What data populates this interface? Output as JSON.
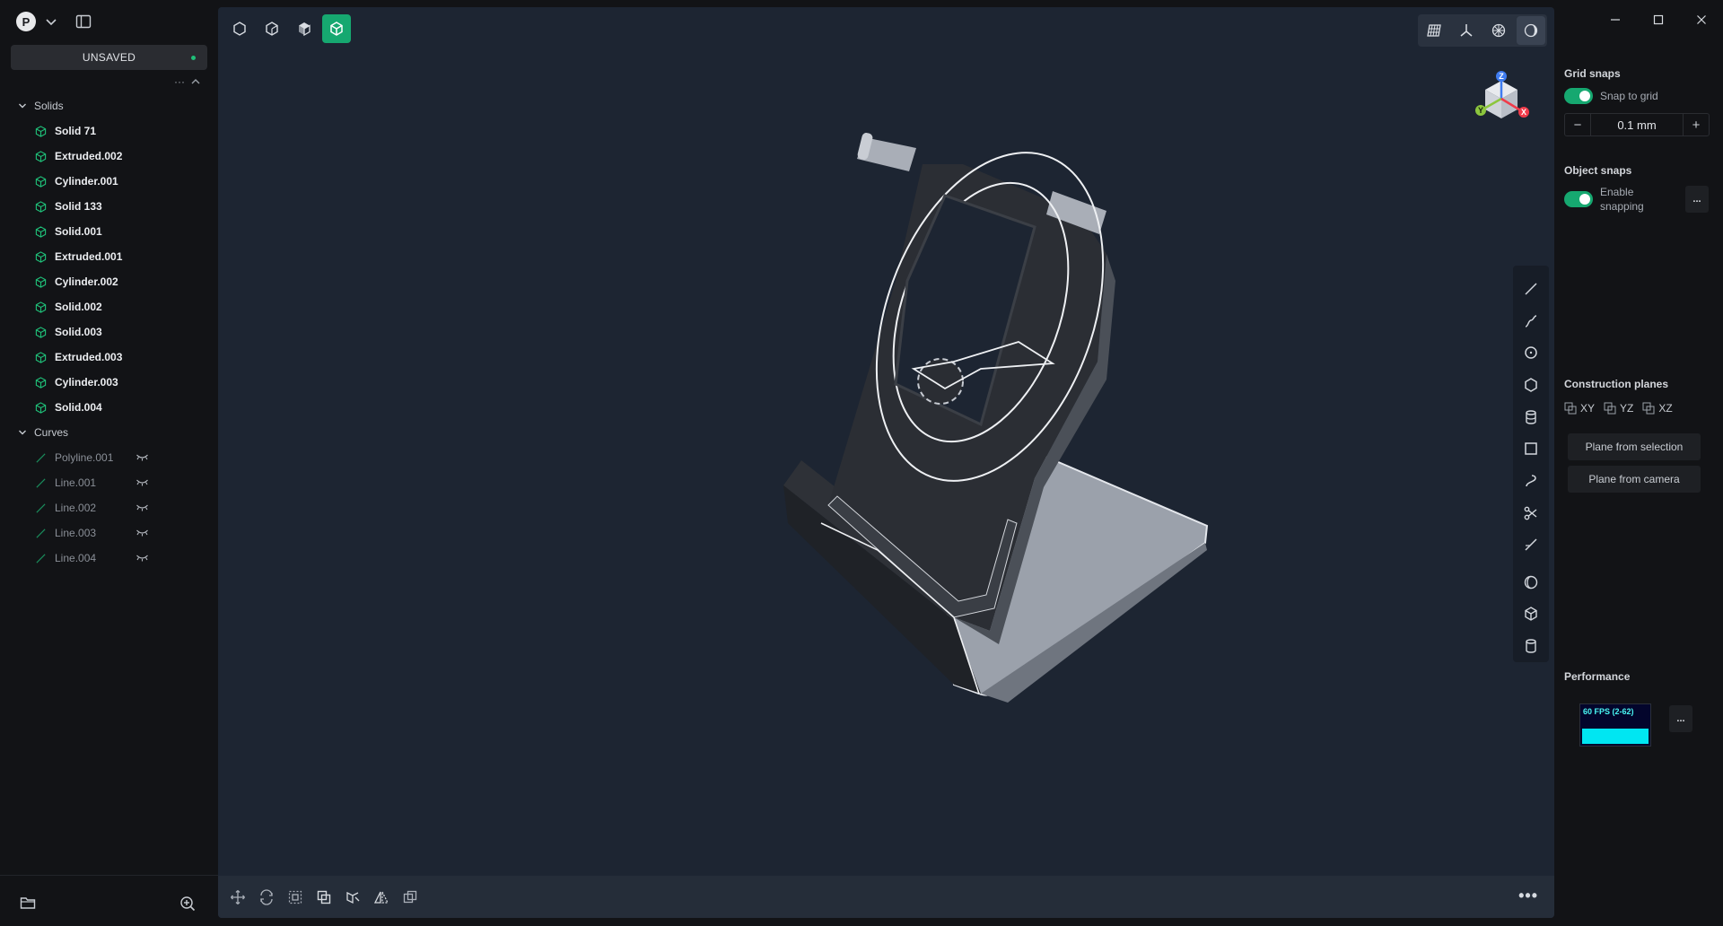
{
  "sidebar": {
    "avatar_letter": "P",
    "status_label": "UNSAVED",
    "tree_more": "···",
    "groups": {
      "solids": {
        "label": "Solids",
        "items": [
          "Solid 71",
          "Extruded.002",
          "Cylinder.001",
          "Solid 133",
          "Solid.001",
          "Extruded.001",
          "Cylinder.002",
          "Solid.002",
          "Solid.003",
          "Extruded.003",
          "Cylinder.003",
          "Solid.004"
        ]
      },
      "curves": {
        "label": "Curves",
        "items": [
          "Polyline.001",
          "Line.001",
          "Line.002",
          "Line.003",
          "Line.004"
        ]
      }
    }
  },
  "viewport": {
    "nav_cube": {
      "z": "Z",
      "y": "Y",
      "x": "X"
    },
    "more": "•••"
  },
  "right_panel": {
    "grid_snaps": {
      "title": "Grid snaps",
      "toggle_label": "Snap to grid",
      "value": "0.1 mm",
      "minus": "−",
      "plus": "+"
    },
    "object_snaps": {
      "title": "Object snaps",
      "toggle_label_1": "Enable",
      "toggle_label_2": "snapping",
      "more": "..."
    },
    "construction_planes": {
      "title": "Construction planes",
      "planes": [
        "XY",
        "YZ",
        "XZ"
      ],
      "plane_from_selection": "Plane from selection",
      "plane_from_camera": "Plane from camera"
    },
    "performance": {
      "title": "Performance",
      "fps_label": "60 FPS (2-62)",
      "more": "..."
    }
  },
  "colors": {
    "accent": "#16a870",
    "viewport_bg": "#1d2532",
    "sidebar_bg": "#121316"
  }
}
